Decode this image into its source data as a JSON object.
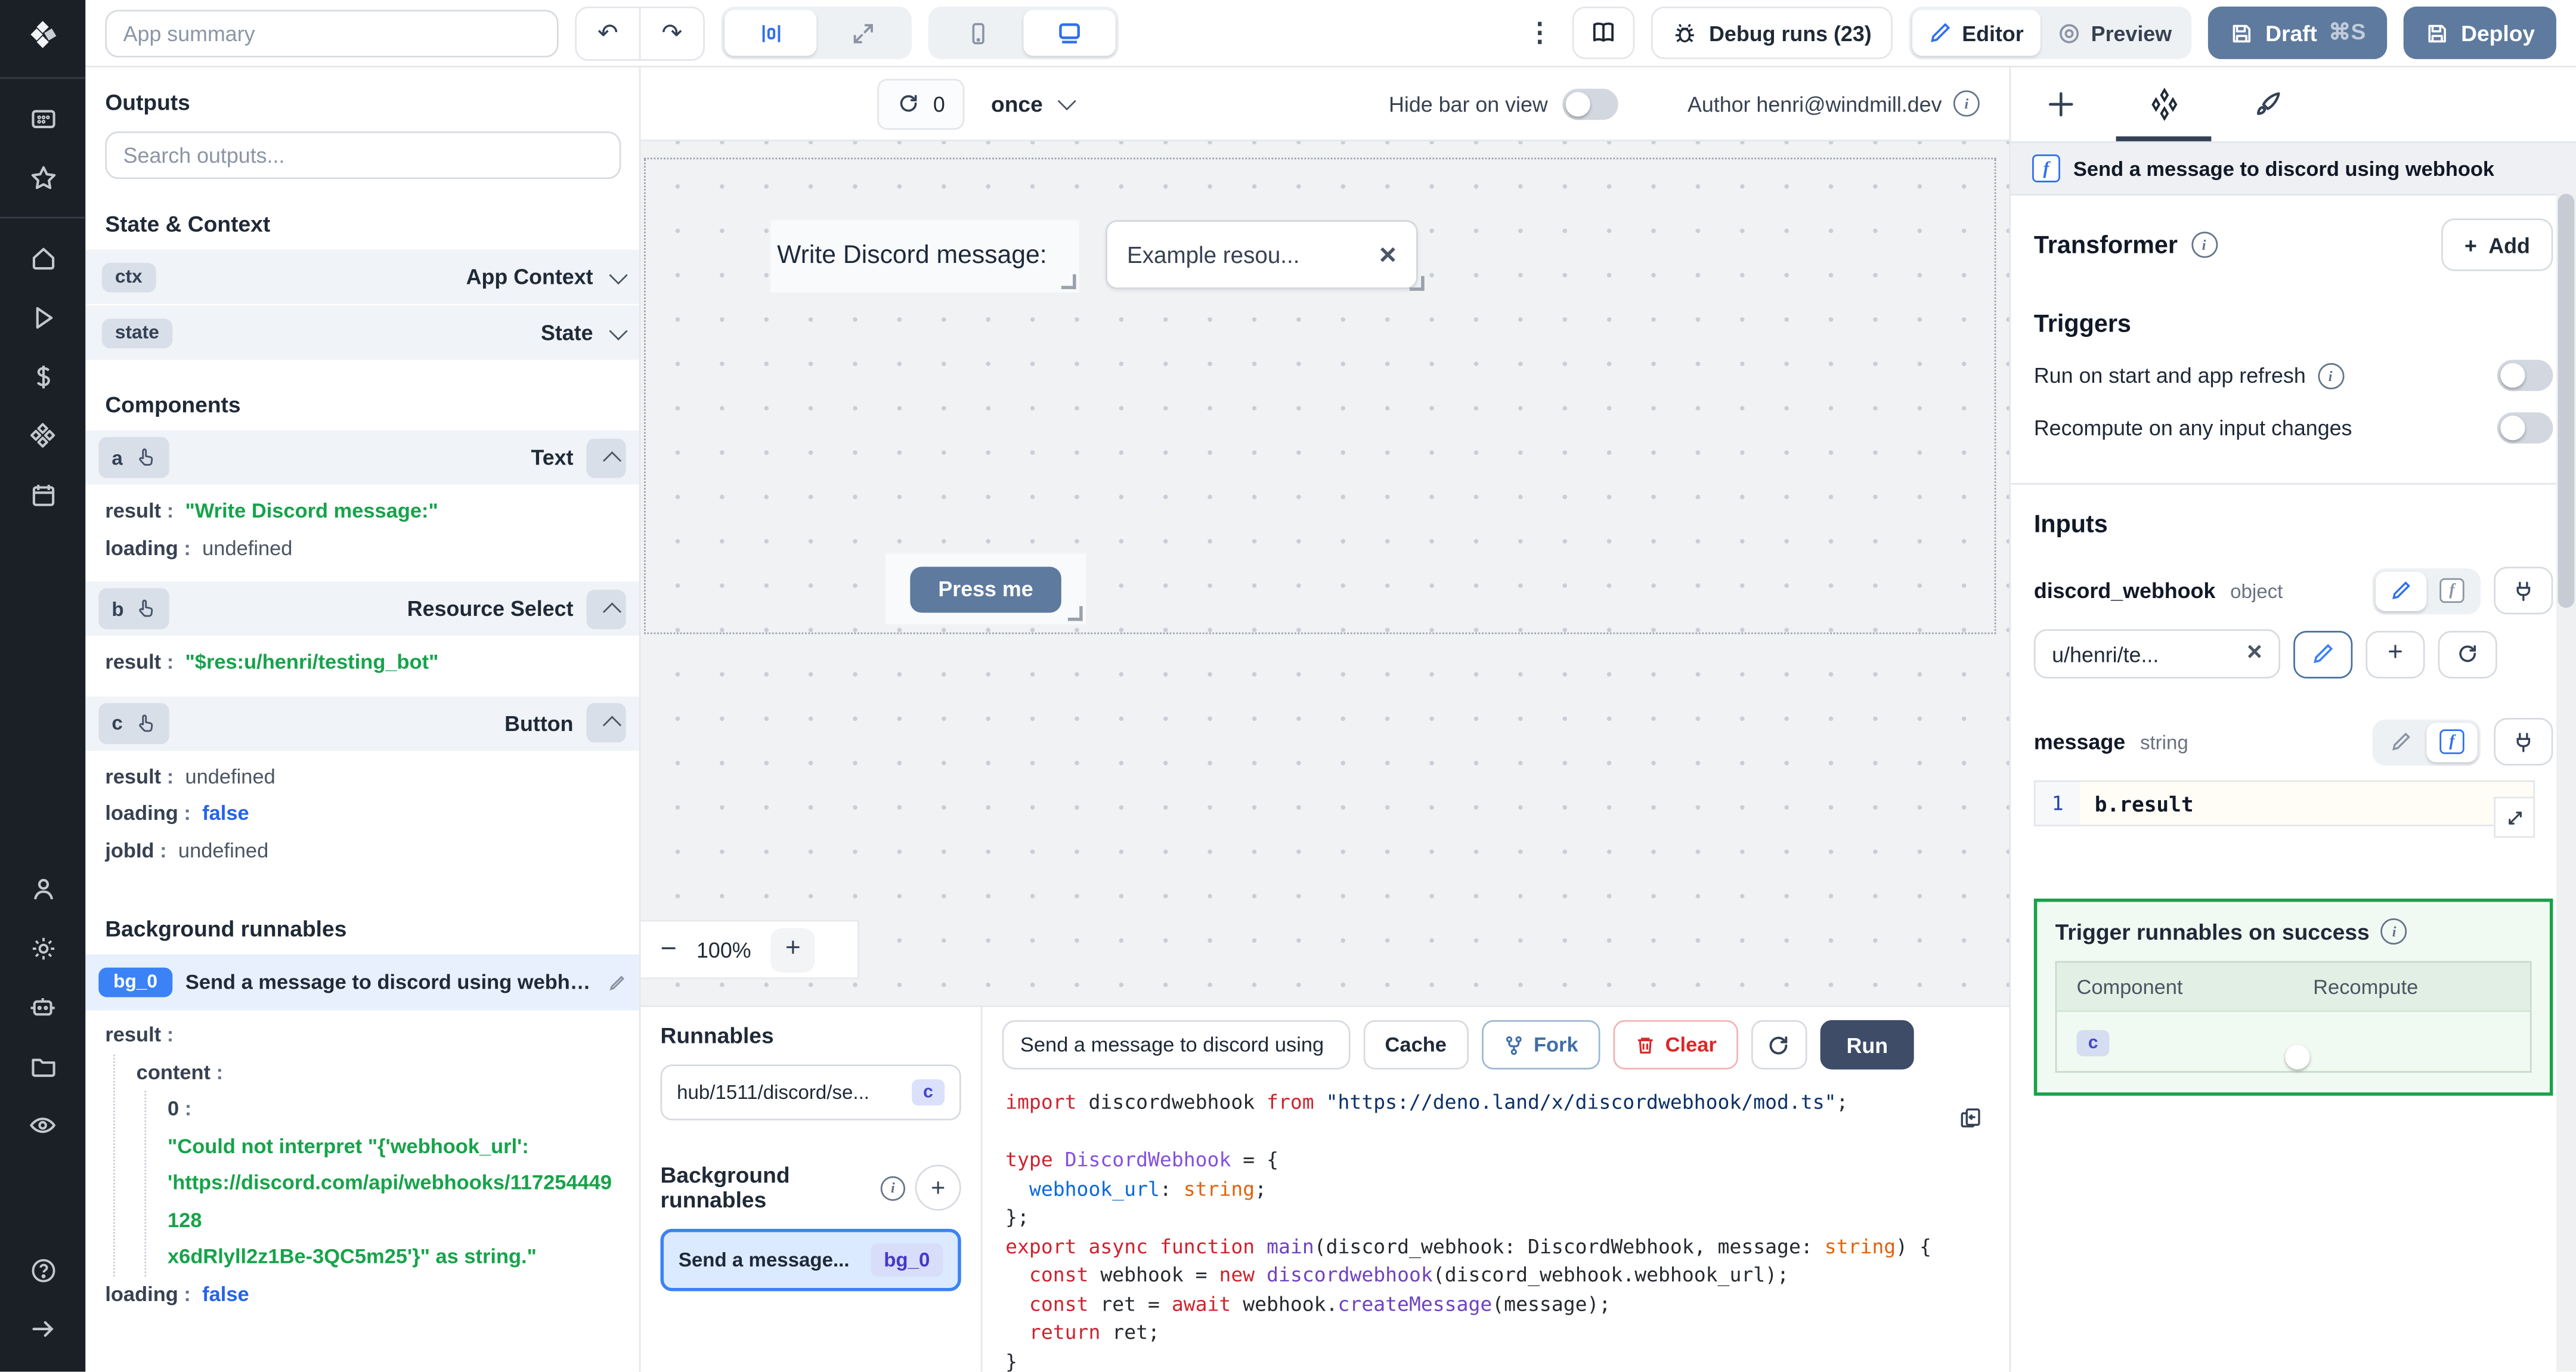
{
  "topbar": {
    "app_summary_placeholder": "App summary",
    "debug_runs_label": "Debug runs (23)",
    "editor_label": "Editor",
    "preview_label": "Preview",
    "draft_label": "Draft",
    "draft_shortcut": "⌘S",
    "deploy_label": "Deploy"
  },
  "outputs_panel": {
    "title": "Outputs",
    "search_placeholder": "Search outputs...",
    "state_context_title": "State & Context",
    "ctx_badge": "ctx",
    "ctx_label": "App Context",
    "state_badge": "state",
    "state_label": "State",
    "components_title": "Components",
    "comp_a": {
      "id": "a",
      "type": "Text",
      "result_key": "result",
      "result_value": "\"Write Discord message:\"",
      "loading_key": "loading",
      "loading_value": "undefined"
    },
    "comp_b": {
      "id": "b",
      "type": "Resource Select",
      "result_key": "result",
      "result_value": "\"$res:u/henri/testing_bot\""
    },
    "comp_c": {
      "id": "c",
      "type": "Button",
      "result_key": "result",
      "result_value": "undefined",
      "loading_key": "loading",
      "loading_value": "false",
      "jobid_key": "jobId",
      "jobid_value": "undefined"
    },
    "background_title": "Background runnables",
    "bg": {
      "badge": "bg_0",
      "label": "Send a message to discord using webhook",
      "result_key": "result",
      "content_key": "content",
      "index_key": "0",
      "error_line1": "\"Could not interpret \"{'webhook_url':",
      "error_line2": "'https://discord.com/api/webhooks/117254449128",
      "error_line3": "x6dRlyll2z1Be-3QC5m25'}\" as string.\"",
      "loading_key": "loading",
      "loading_value": "false"
    }
  },
  "canvas": {
    "refresh_count": "0",
    "schedule": "once",
    "hide_bar_label": "Hide bar on view",
    "author_label": "Author henri@windmill.dev",
    "text_component": "Write Discord message:",
    "select_value": "Example resou...",
    "button_label": "Press me",
    "zoom_value": "100%"
  },
  "runnables": {
    "title": "Runnables",
    "item_label": "hub/1511/discord/se...",
    "item_badge": "c",
    "background_title": "Background runnables",
    "bg_item_label": "Send a message...",
    "bg_item_badge": "bg_0"
  },
  "editor": {
    "name_value": "Send a message to discord using",
    "cache_label": "Cache",
    "fork_label": "Fork",
    "clear_label": "Clear",
    "run_label": "Run"
  },
  "code": {
    "lines": [
      [
        {
          "t": "import",
          "c": "kw"
        },
        {
          "t": " discordwebhook ",
          "c": "plain"
        },
        {
          "t": "from",
          "c": "kw"
        },
        {
          "t": " ",
          "c": "plain"
        },
        {
          "t": "\"https://deno.land/x/discordwebhook/mod.ts\"",
          "c": "str"
        },
        {
          "t": ";",
          "c": "plain"
        }
      ],
      [],
      [
        {
          "t": "type",
          "c": "kw"
        },
        {
          "t": " ",
          "c": "plain"
        },
        {
          "t": "DiscordWebhook",
          "c": "type"
        },
        {
          "t": " = {",
          "c": "plain"
        }
      ],
      [
        {
          "t": "  ",
          "c": "plain"
        },
        {
          "t": "webhook_url",
          "c": "prop"
        },
        {
          "t": ": ",
          "c": "plain"
        },
        {
          "t": "string",
          "c": "orange"
        },
        {
          "t": ";",
          "c": "plain"
        }
      ],
      [
        {
          "t": "};",
          "c": "plain"
        }
      ],
      [
        {
          "t": "export",
          "c": "kw"
        },
        {
          "t": " ",
          "c": "plain"
        },
        {
          "t": "async",
          "c": "kw"
        },
        {
          "t": " ",
          "c": "plain"
        },
        {
          "t": "function",
          "c": "kw"
        },
        {
          "t": " ",
          "c": "plain"
        },
        {
          "t": "main",
          "c": "fn"
        },
        {
          "t": "(discord_webhook: DiscordWebhook, message: ",
          "c": "plain"
        },
        {
          "t": "string",
          "c": "orange"
        },
        {
          "t": ") {",
          "c": "plain"
        }
      ],
      [
        {
          "t": "  ",
          "c": "plain"
        },
        {
          "t": "const",
          "c": "kw"
        },
        {
          "t": " webhook = ",
          "c": "plain"
        },
        {
          "t": "new",
          "c": "kw"
        },
        {
          "t": " ",
          "c": "plain"
        },
        {
          "t": "discordwebhook",
          "c": "fn"
        },
        {
          "t": "(discord_webhook.webhook_url);",
          "c": "plain"
        }
      ],
      [
        {
          "t": "  ",
          "c": "plain"
        },
        {
          "t": "const",
          "c": "kw"
        },
        {
          "t": " ret = ",
          "c": "plain"
        },
        {
          "t": "await",
          "c": "kw"
        },
        {
          "t": " webhook.",
          "c": "plain"
        },
        {
          "t": "createMessage",
          "c": "fn"
        },
        {
          "t": "(message);",
          "c": "plain"
        }
      ],
      [
        {
          "t": "  ",
          "c": "plain"
        },
        {
          "t": "return",
          "c": "kw"
        },
        {
          "t": " ret;",
          "c": "plain"
        }
      ],
      [
        {
          "t": "}",
          "c": "plain"
        }
      ]
    ]
  },
  "right_panel": {
    "header": "Send a message to discord using webhook",
    "transformer_title": "Transformer",
    "add_label": "Add",
    "triggers_title": "Triggers",
    "toggle1_label": "Run on start and app refresh",
    "toggle2_label": "Recompute on any input changes",
    "inputs_title": "Inputs",
    "input1_name": "discord_webhook",
    "input1_type": "object",
    "input1_value": "u/henri/te...",
    "input2_name": "message",
    "input2_type": "string",
    "input2_line": "1",
    "input2_code": "b.result",
    "success_title": "Trigger runnables on success",
    "success_col1": "Component",
    "success_col2": "Recompute",
    "success_badge": "c"
  },
  "colors": {
    "accent": "#2f6fed",
    "steel": "#5e7a9e",
    "run_button": "#3e4c68",
    "success_green": "#16a34a"
  }
}
